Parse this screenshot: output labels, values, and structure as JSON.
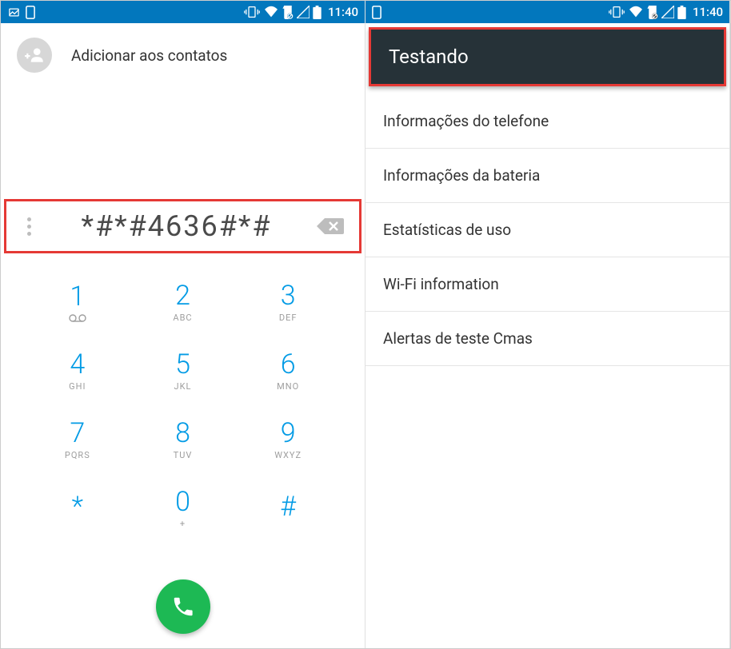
{
  "status": {
    "time": "11:40"
  },
  "dialer": {
    "add_contacts_label": "Adicionar aos contatos",
    "number": "*#*#4636#*#",
    "keys": [
      {
        "digit": "1",
        "letters": ""
      },
      {
        "digit": "2",
        "letters": "ABC"
      },
      {
        "digit": "3",
        "letters": "DEF"
      },
      {
        "digit": "4",
        "letters": "GHI"
      },
      {
        "digit": "5",
        "letters": "JKL"
      },
      {
        "digit": "6",
        "letters": "MNO"
      },
      {
        "digit": "7",
        "letters": "PQRS"
      },
      {
        "digit": "8",
        "letters": "TUV"
      },
      {
        "digit": "9",
        "letters": "WXYZ"
      },
      {
        "digit": "*",
        "letters": ""
      },
      {
        "digit": "0",
        "letters": "+"
      },
      {
        "digit": "#",
        "letters": ""
      }
    ]
  },
  "testing": {
    "title": "Testando",
    "items": [
      "Informações do telefone",
      "Informações da bateria",
      "Estatísticas de uso",
      "Wi-Fi information",
      "Alertas de teste Cmas"
    ]
  }
}
